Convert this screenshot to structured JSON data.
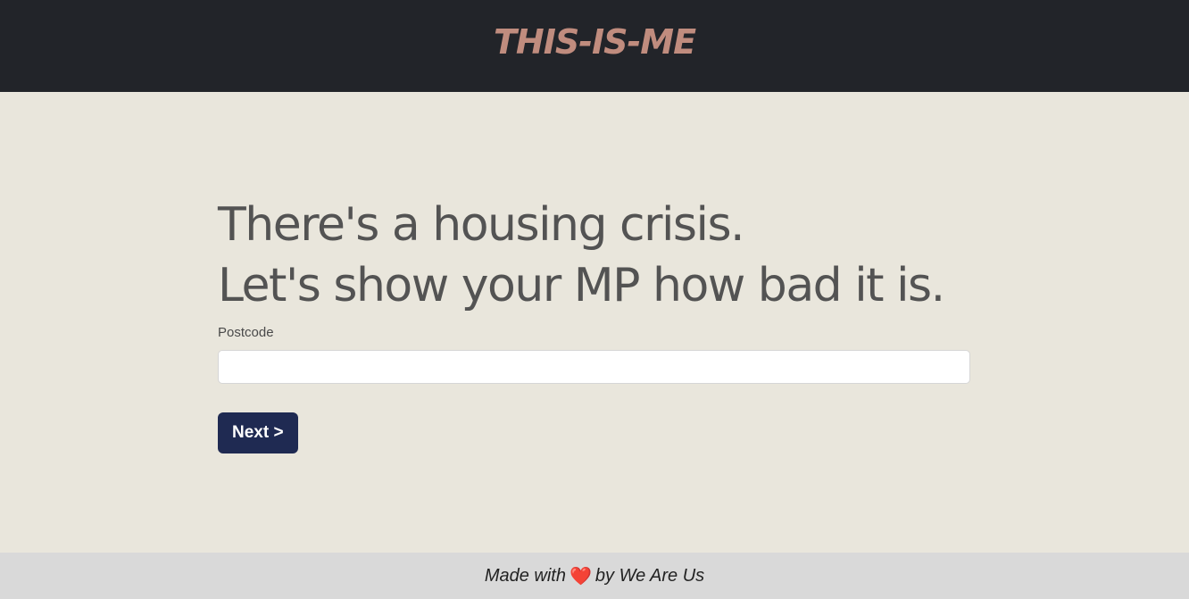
{
  "header": {
    "logo_text": "THIS-IS-ME"
  },
  "main": {
    "headline_line1": "There's a housing crisis.",
    "headline_line2": "Let's show your MP how bad it is.",
    "postcode": {
      "label": "Postcode",
      "value": "",
      "placeholder": ""
    },
    "next_label": "Next >"
  },
  "footer": {
    "prefix": "Made with",
    "heart": "❤️",
    "suffix": "by We Are Us"
  },
  "colors": {
    "header_bg": "#222429",
    "logo": "#c08c7e",
    "page_bg": "#e9e6dc",
    "button_bg": "#1f2a52",
    "footer_bg": "#d9d9d9"
  }
}
